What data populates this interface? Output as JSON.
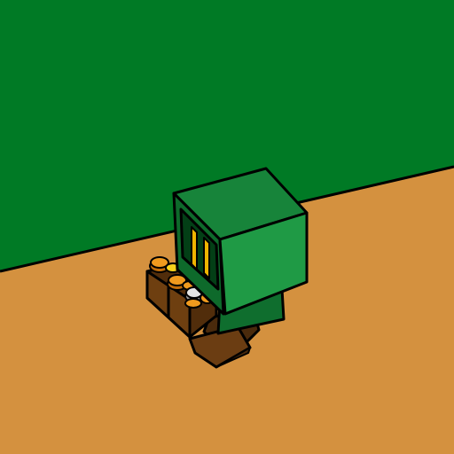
{
  "scene": {
    "colors": {
      "background_wall": "#007a25",
      "floor": "#d4913f",
      "outline": "#000000",
      "cube_front": "#1f9a45",
      "cube_top": "#17843a",
      "cube_side": "#0e6a2b",
      "screen": "#033f16",
      "screen_bar": "#f0b400",
      "body_green": "#0f6e2e",
      "leg_brown": "#6b3d12",
      "leg_brown_dark": "#4a2a0c",
      "crate_brown": "#6e3f10",
      "crate_brown_dark": "#512d0b",
      "coin_orange": "#f09a1e",
      "coin_orange_dark": "#c06c0a",
      "coin_yellow": "#f7d21b",
      "coin_silver": "#e6e6e6",
      "coin_silver_dark": "#9a9a9a"
    },
    "objects": {
      "character": "robot-character",
      "crate": "coin-crate",
      "coins": [
        "orange-coin",
        "orange-coin",
        "orange-coin",
        "orange-coin",
        "yellow-coin",
        "silver-coin"
      ]
    }
  }
}
